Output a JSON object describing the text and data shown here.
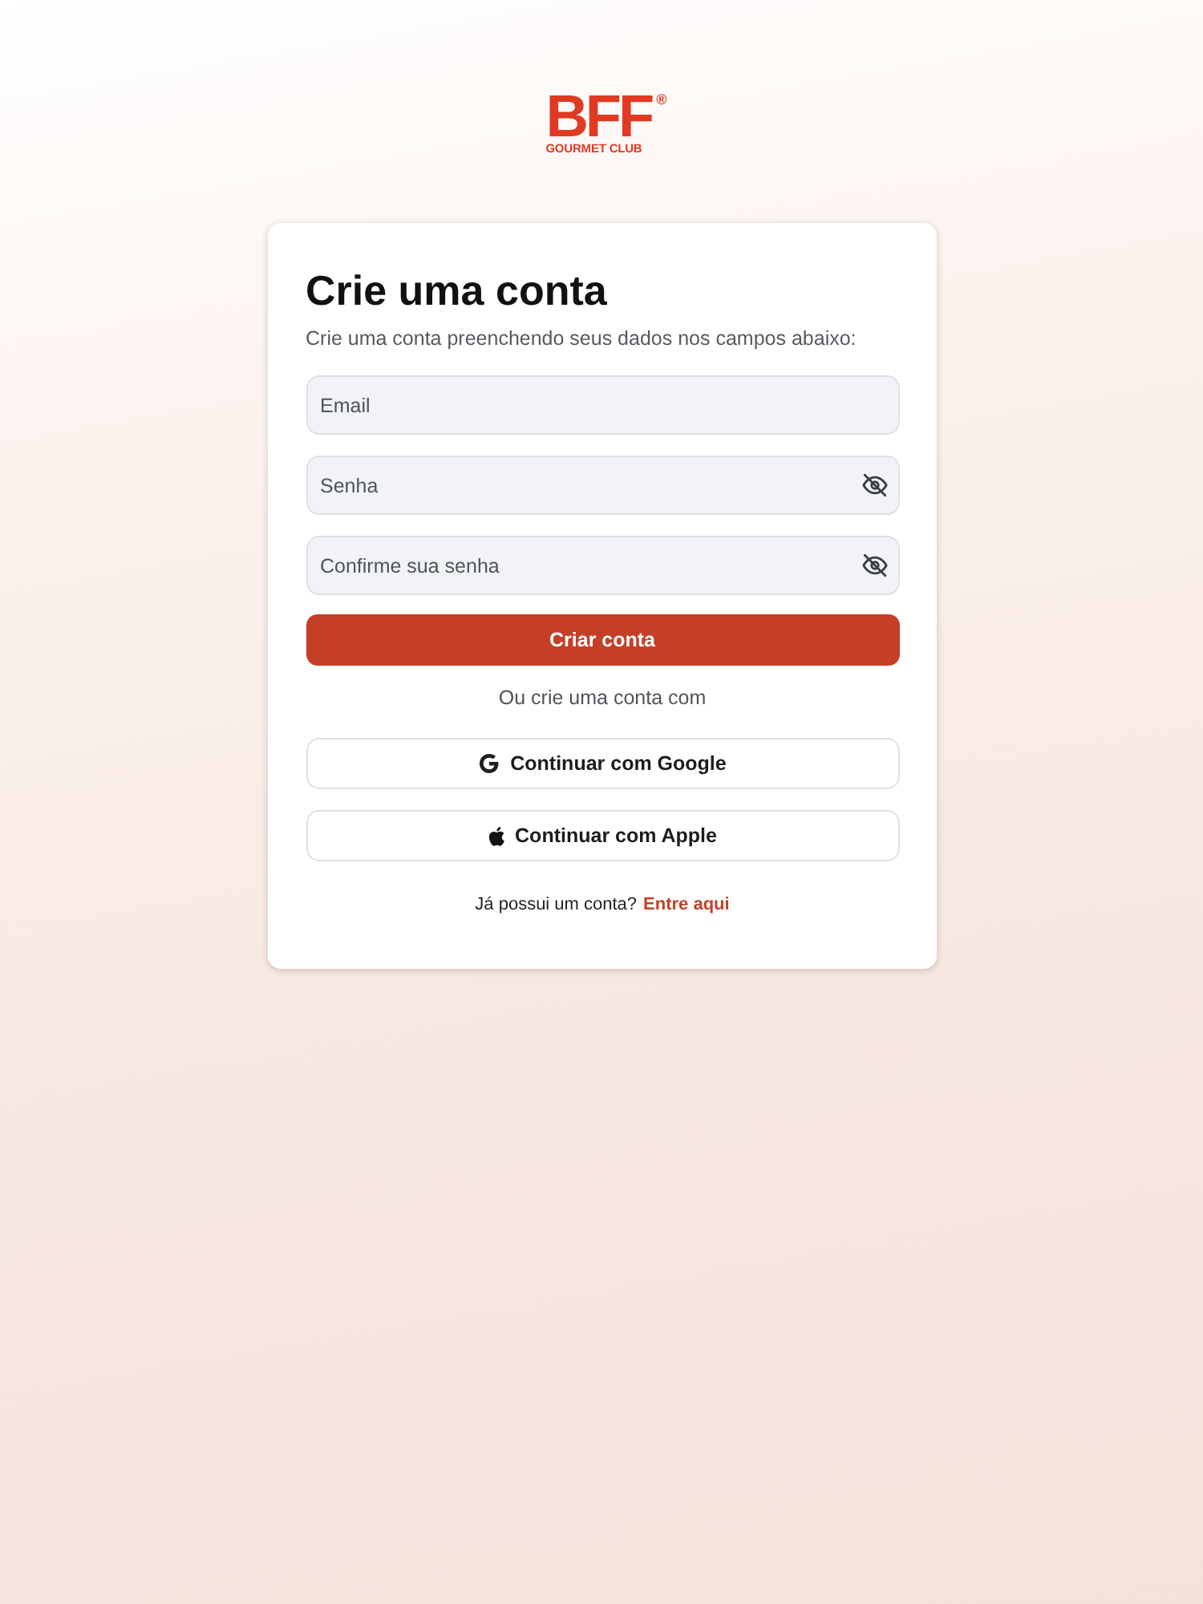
{
  "logo": {
    "brand": "BFF",
    "registered": "®",
    "tagline": "GOURMET CLUB"
  },
  "card": {
    "title": "Crie uma conta",
    "subtitle": "Crie uma conta preenchendo seus dados nos campos abaixo:",
    "fields": [
      {
        "kind": "email",
        "placeholder": "Email"
      },
      {
        "kind": "password",
        "placeholder": "Senha"
      },
      {
        "kind": "password",
        "placeholder": "Confirme sua senha"
      }
    ],
    "submit": "Criar conta",
    "divider_text": "Ou crie uma conta com",
    "social_buttons": [
      {
        "kind": "google",
        "label": "Continuar com Google"
      },
      {
        "kind": "apple",
        "label": "Continuar com Apple"
      }
    ],
    "footer": {
      "text": "Já possui um conta?",
      "link": "Entre aqui"
    }
  }
}
